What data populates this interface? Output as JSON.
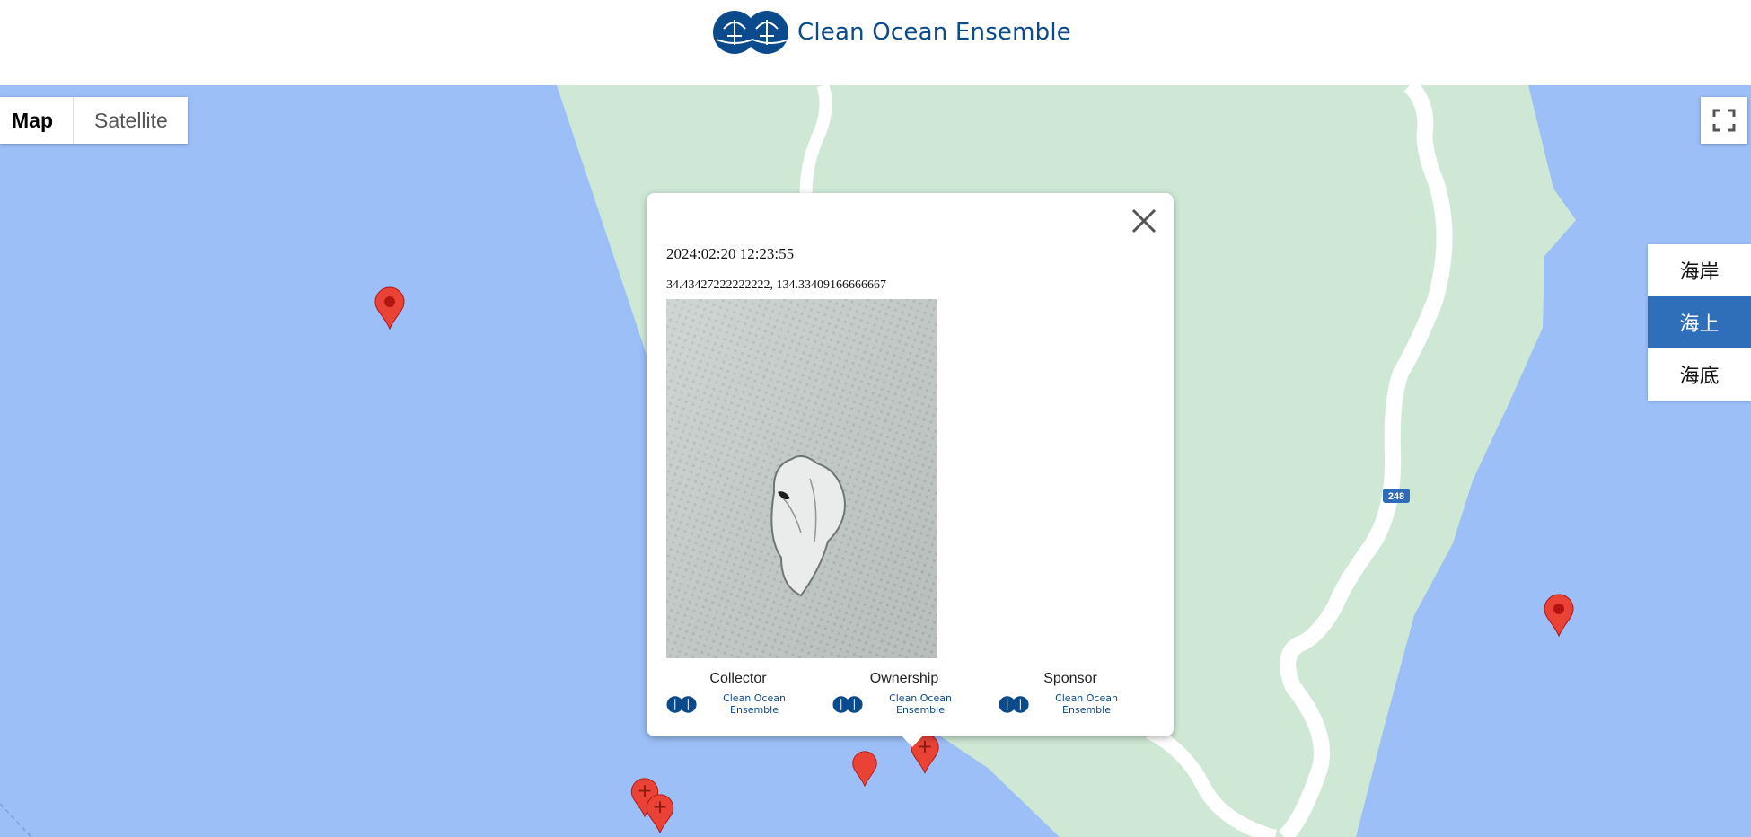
{
  "header": {
    "brand": "Clean Ocean Ensemble"
  },
  "map_controls": {
    "map_label": "Map",
    "satellite_label": "Satellite",
    "active": "Map"
  },
  "layers": {
    "items": [
      {
        "label": "海岸"
      },
      {
        "label": "海上"
      },
      {
        "label": "海底"
      }
    ],
    "selected": "海上"
  },
  "road": {
    "shield": "248"
  },
  "popup": {
    "timestamp": "2024:02:20 12:23:55",
    "coordinates": "34.43427222222222, 134.33409166666667",
    "credits": [
      {
        "label": "Collector",
        "org": "Clean Ocean Ensemble"
      },
      {
        "label": "Ownership",
        "org": "Clean Ocean Ensemble"
      },
      {
        "label": "Sponsor",
        "org": "Clean Ocean Ensemble"
      }
    ]
  },
  "colors": {
    "water": "#9cbff7",
    "land": "#cfe8d6",
    "road": "#ffffff",
    "marker": "#ea4335",
    "brand": "#0b4a8b",
    "selected_layer": "#2f6fba"
  },
  "icons": {
    "close": "close-icon",
    "fullscreen": "fullscreen-icon",
    "marker": "map-pin-icon"
  }
}
